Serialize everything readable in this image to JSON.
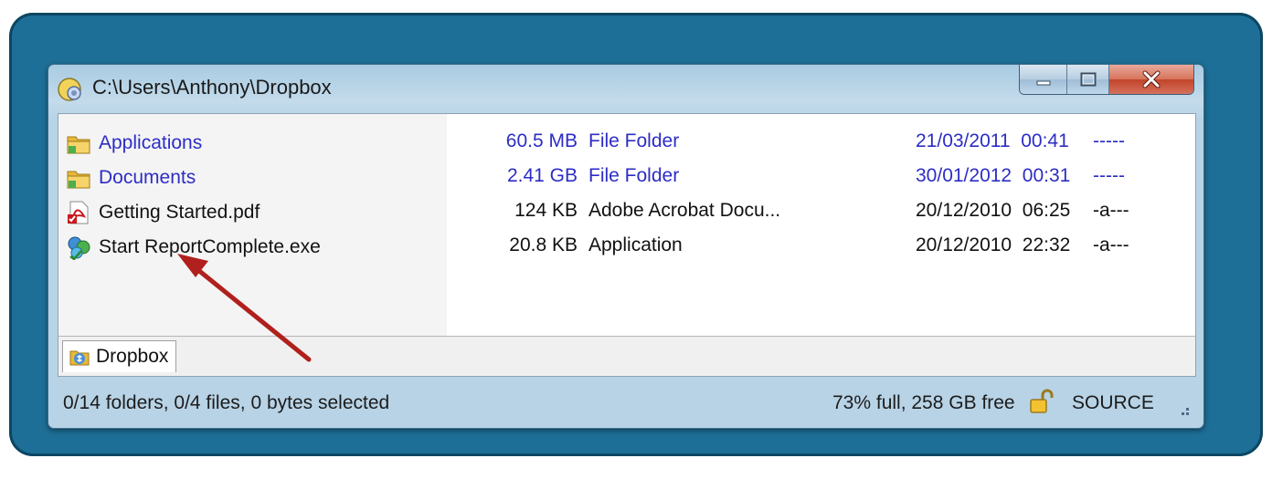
{
  "window": {
    "title": "C:\\Users\\Anthony\\Dropbox"
  },
  "files": [
    {
      "name": "Applications",
      "size": "60.5 MB",
      "type": "File Folder",
      "date": "21/03/2011",
      "time": "00:41",
      "attr": "-----",
      "kind": "folder",
      "icon": "folder-icon"
    },
    {
      "name": "Documents",
      "size": "2.41 GB",
      "type": "File Folder",
      "date": "30/01/2012",
      "time": "00:31",
      "attr": "-----",
      "kind": "folder",
      "icon": "folder-icon"
    },
    {
      "name": "Getting Started.pdf",
      "size": "124 KB",
      "type": "Adobe Acrobat Docu...",
      "date": "20/12/2010",
      "time": "06:25",
      "attr": "-a---",
      "kind": "file",
      "icon": "pdf-icon"
    },
    {
      "name": "Start ReportComplete.exe",
      "size": "20.8 KB",
      "type": "Application",
      "date": "20/12/2010",
      "time": "22:32",
      "attr": "-a---",
      "kind": "file",
      "icon": "exe-icon"
    }
  ],
  "tabs": [
    {
      "label": "Dropbox",
      "icon": "dropbox-folder-icon"
    }
  ],
  "status": {
    "selection": "0/14 folders, 0/4 files, 0 bytes selected",
    "free": "73% full, 258 GB free",
    "source": "SOURCE"
  },
  "colors": {
    "frame": "#1d6f97",
    "folder_text": "#2d2dc5",
    "arrow": "#b0201d"
  }
}
